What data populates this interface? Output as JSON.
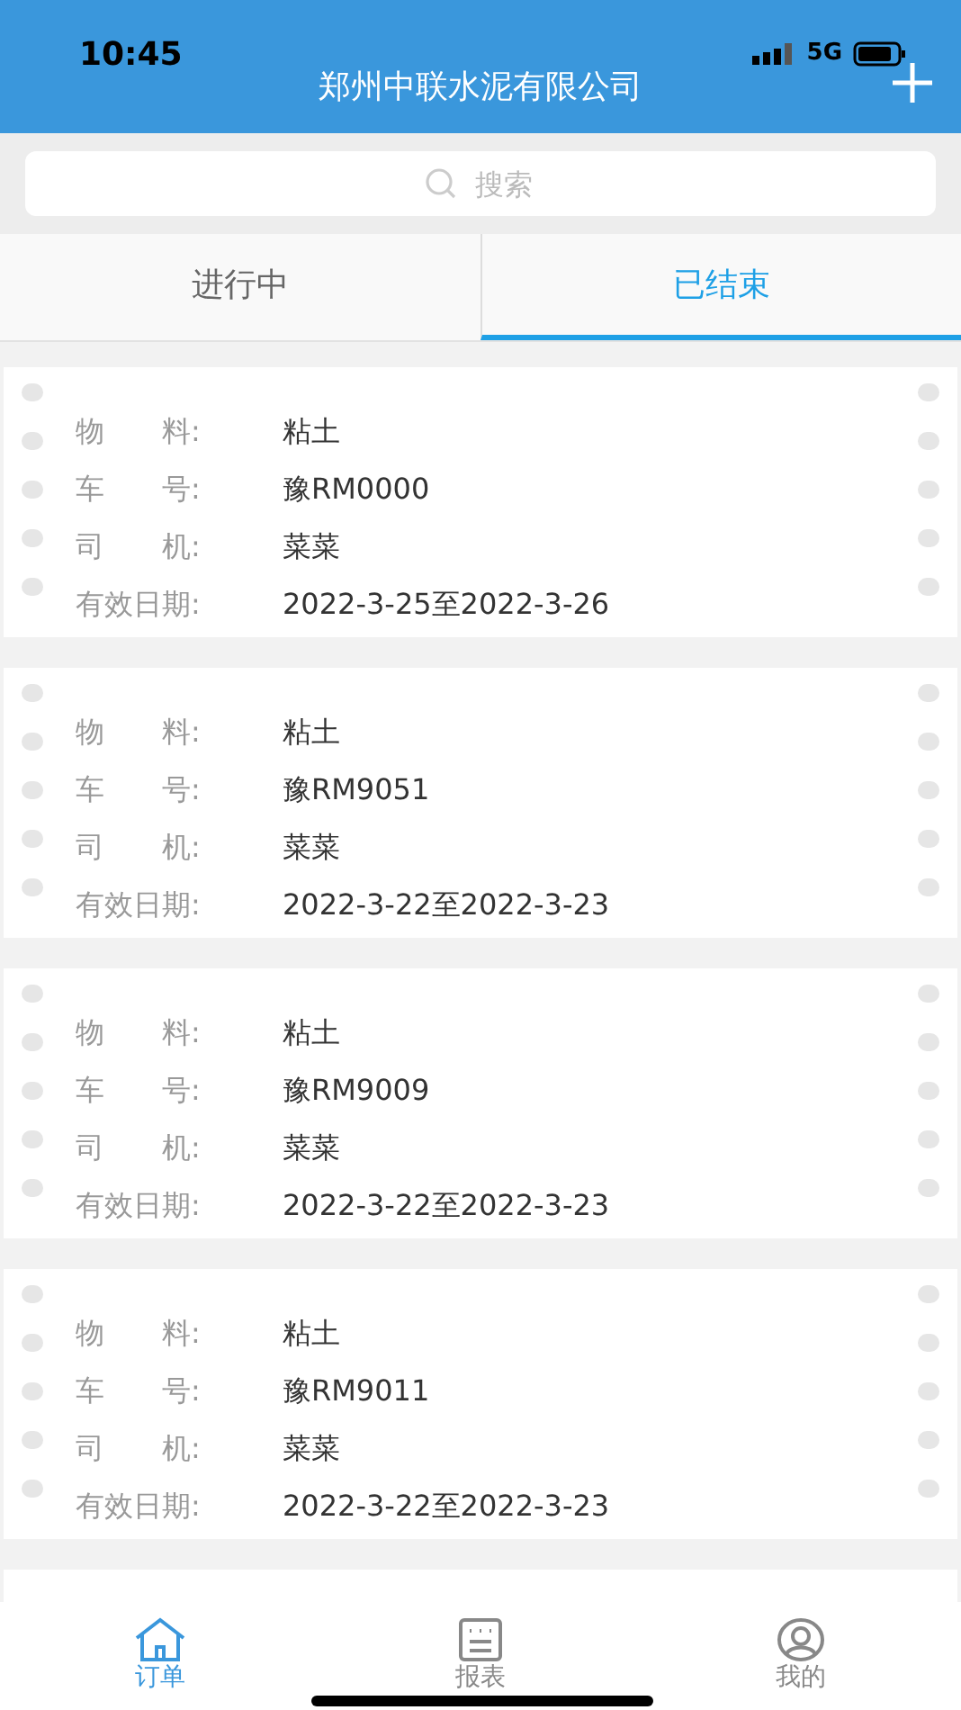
{
  "status_bar": {
    "time": "10:45",
    "network": "5G"
  },
  "header": {
    "title": "郑州中联水泥有限公司"
  },
  "search": {
    "placeholder": "搜索"
  },
  "tabs": [
    {
      "label": "进行中",
      "selected": false
    },
    {
      "label": "已结束",
      "selected": true
    }
  ],
  "orders": [
    {
      "fields": [
        {
          "label": "物　　料:",
          "value": "粘土"
        },
        {
          "label": "车　　号:",
          "value": "豫RM0000"
        },
        {
          "label": "司　　机:",
          "value": "菜菜"
        },
        {
          "label": "有效日期:",
          "value": "2022-3-25至2022-3-26"
        }
      ]
    },
    {
      "fields": [
        {
          "label": "物　　料:",
          "value": "粘土"
        },
        {
          "label": "车　　号:",
          "value": "豫RM9051"
        },
        {
          "label": "司　　机:",
          "value": "菜菜"
        },
        {
          "label": "有效日期:",
          "value": "2022-3-22至2022-3-23"
        }
      ]
    },
    {
      "fields": [
        {
          "label": "物　　料:",
          "value": "粘土"
        },
        {
          "label": "车　　号:",
          "value": "豫RM9009"
        },
        {
          "label": "司　　机:",
          "value": "菜菜"
        },
        {
          "label": "有效日期:",
          "value": "2022-3-22至2022-3-23"
        }
      ]
    },
    {
      "fields": [
        {
          "label": "物　　料:",
          "value": "粘土"
        },
        {
          "label": "车　　号:",
          "value": "豫RM9011"
        },
        {
          "label": "司　　机:",
          "value": "菜菜"
        },
        {
          "label": "有效日期:",
          "value": "2022-3-22至2022-3-23"
        }
      ]
    }
  ],
  "bottom_nav": [
    {
      "kind": "home",
      "label": "订单",
      "selected": true
    },
    {
      "kind": "report",
      "label": "报表",
      "selected": false
    },
    {
      "kind": "profile",
      "label": "我的",
      "selected": false
    }
  ]
}
